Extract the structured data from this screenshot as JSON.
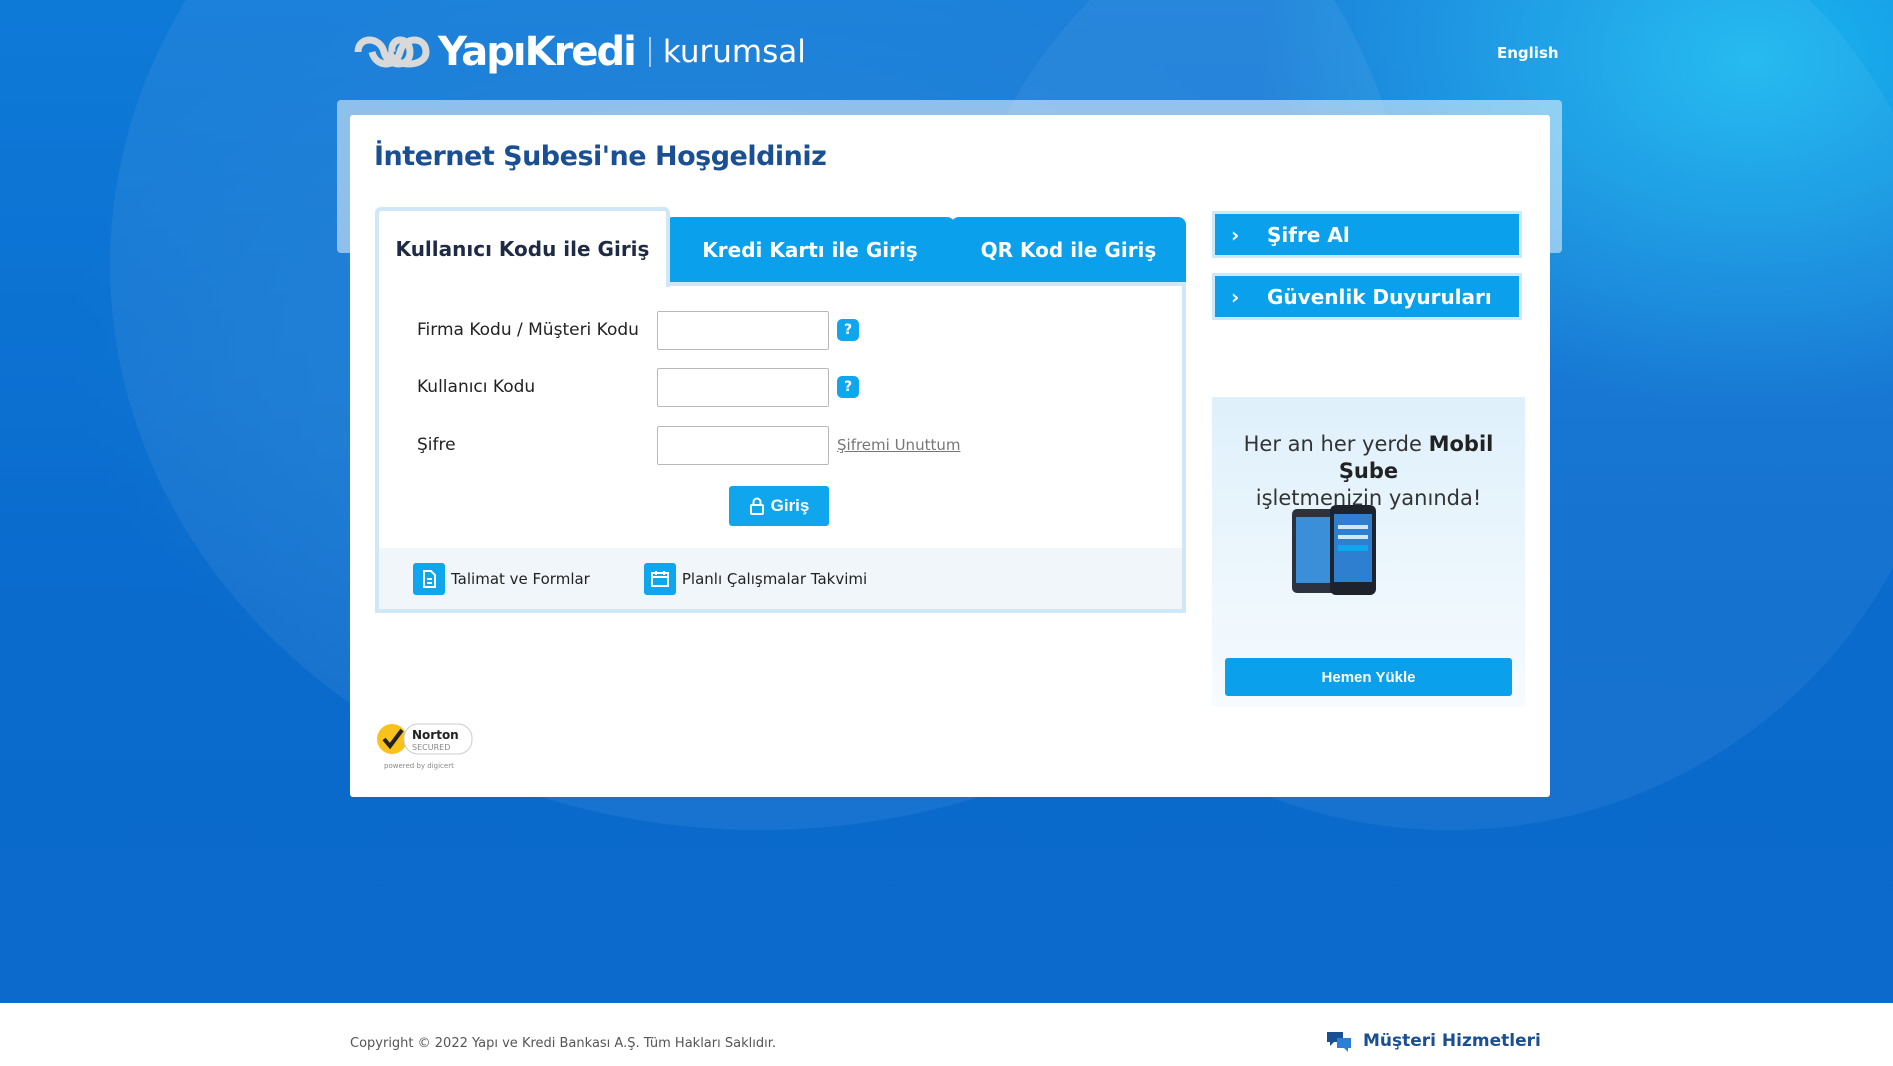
{
  "header": {
    "brand": "YapıKredi",
    "sub": "kurumsal",
    "lang_link": "English"
  },
  "page": {
    "title": "İnternet Şubesi'ne Hoşgeldiniz"
  },
  "tabs": [
    {
      "label": "Kullanıcı Kodu ile Giriş",
      "active": true
    },
    {
      "label": "Kredi Kartı ile Giriş",
      "active": false
    },
    {
      "label": "QR Kod ile Giriş",
      "active": false
    }
  ],
  "form": {
    "firm_label": "Firma Kodu / Müşteri Kodu",
    "user_label": "Kullanıcı Kodu",
    "password_label": "Şifre",
    "firm_value": "",
    "user_value": "",
    "password_value": "",
    "help_glyph": "?",
    "forgot_link": "Şifremi Unuttum",
    "login_button": "Giriş"
  },
  "bottom_links": {
    "forms": "Talimat ve Formlar",
    "calendar": "Planlı Çalışmalar Takvimi"
  },
  "side": {
    "get_password": "Şifre Al",
    "security": "Güvenlik Duyuruları",
    "promo_line1_pre": "Her an her yerde ",
    "promo_line1_bold": "Mobil Şube",
    "promo_line2": "işletmenizin yanında!",
    "promo_button": "Hemen Yükle"
  },
  "norton": {
    "name": "Norton",
    "secured": "SECURED",
    "powered": "powered by digicert"
  },
  "footer": {
    "copyright": "Copyright © 2022 Yapı ve Kredi Bankası A.Ş. Tüm Hakları Saklıdır.",
    "support": "Müşteri Hizmetleri"
  },
  "colors": {
    "accent": "#0aa0ec",
    "title": "#1a4f93",
    "tab_border": "#cfe7f7"
  }
}
